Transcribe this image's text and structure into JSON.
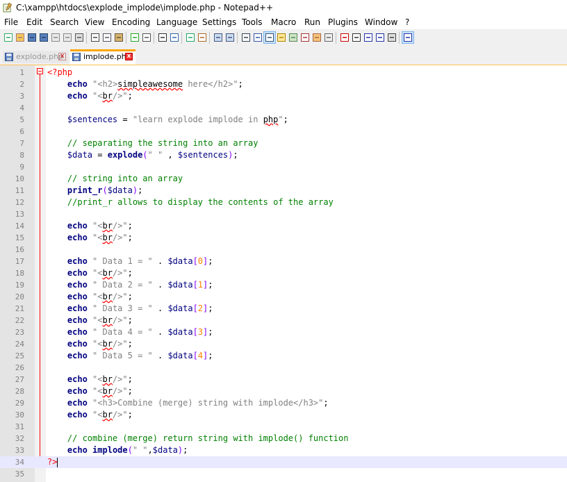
{
  "window": {
    "title": "C:\\xampp\\htdocs\\explode_implode\\implode.php - Notepad++"
  },
  "menu": [
    "File",
    "Edit",
    "Search",
    "View",
    "Encoding",
    "Language",
    "Settings",
    "Tools",
    "Macro",
    "Run",
    "Plugins",
    "Window",
    "?"
  ],
  "tabs": [
    {
      "label": "explode.php",
      "active": false
    },
    {
      "label": "implode.php",
      "active": true
    }
  ],
  "editor": {
    "current_line": 34,
    "lines": [
      [
        [
          "php",
          "<?php"
        ]
      ],
      [
        [
          "t",
          "    "
        ],
        [
          "kw",
          "echo"
        ],
        [
          "t",
          " "
        ],
        [
          "str",
          "\"<h2>"
        ],
        [
          "sq",
          "simpleawesome"
        ],
        [
          "str",
          " here</h2>\""
        ],
        [
          "t",
          ";"
        ]
      ],
      [
        [
          "t",
          "    "
        ],
        [
          "kw",
          "echo"
        ],
        [
          "t",
          " "
        ],
        [
          "str",
          "\"<"
        ],
        [
          "sq",
          "br"
        ],
        [
          "str",
          "/>\""
        ],
        [
          "t",
          ";"
        ]
      ],
      [],
      [
        [
          "t",
          "    "
        ],
        [
          "var",
          "$sentences"
        ],
        [
          "t",
          " = "
        ],
        [
          "str",
          "\"learn explode implode in "
        ],
        [
          "sq",
          "php"
        ],
        [
          "str",
          "\""
        ],
        [
          "t",
          ";"
        ]
      ],
      [],
      [
        [
          "t",
          "    "
        ],
        [
          "cmt",
          "// separating the string into an array"
        ]
      ],
      [
        [
          "t",
          "    "
        ],
        [
          "var",
          "$data"
        ],
        [
          "t",
          " = "
        ],
        [
          "kw",
          "explode"
        ],
        [
          "op",
          "("
        ],
        [
          "str",
          "\" \""
        ],
        [
          "t",
          " , "
        ],
        [
          "var",
          "$sentences"
        ],
        [
          "op",
          ")"
        ],
        [
          "t",
          ";"
        ]
      ],
      [],
      [
        [
          "t",
          "    "
        ],
        [
          "cmt",
          "// string into an array"
        ]
      ],
      [
        [
          "t",
          "    "
        ],
        [
          "kw",
          "print_r"
        ],
        [
          "op",
          "("
        ],
        [
          "var",
          "$data"
        ],
        [
          "op",
          ")"
        ],
        [
          "t",
          ";"
        ]
      ],
      [
        [
          "t",
          "    "
        ],
        [
          "cmt",
          "//print_r allows to display the contents of the array"
        ]
      ],
      [],
      [
        [
          "t",
          "    "
        ],
        [
          "kw",
          "echo"
        ],
        [
          "t",
          " "
        ],
        [
          "str",
          "\"<"
        ],
        [
          "sq",
          "br"
        ],
        [
          "str",
          "/>\""
        ],
        [
          "t",
          ";"
        ]
      ],
      [
        [
          "t",
          "    "
        ],
        [
          "kw",
          "echo"
        ],
        [
          "t",
          " "
        ],
        [
          "str",
          "\"<"
        ],
        [
          "sq",
          "br"
        ],
        [
          "str",
          "/>\""
        ],
        [
          "t",
          ";"
        ]
      ],
      [],
      [
        [
          "t",
          "    "
        ],
        [
          "kw",
          "echo"
        ],
        [
          "t",
          " "
        ],
        [
          "str",
          "\" Data 1 = \""
        ],
        [
          "t",
          " . "
        ],
        [
          "var",
          "$data"
        ],
        [
          "op",
          "["
        ],
        [
          "num",
          "0"
        ],
        [
          "op",
          "]"
        ],
        [
          "t",
          ";"
        ]
      ],
      [
        [
          "t",
          "    "
        ],
        [
          "kw",
          "echo"
        ],
        [
          "t",
          " "
        ],
        [
          "str",
          "\"<"
        ],
        [
          "sq",
          "br"
        ],
        [
          "str",
          "/>\""
        ],
        [
          "t",
          ";"
        ]
      ],
      [
        [
          "t",
          "    "
        ],
        [
          "kw",
          "echo"
        ],
        [
          "t",
          " "
        ],
        [
          "str",
          "\" Data 2 = \""
        ],
        [
          "t",
          " . "
        ],
        [
          "var",
          "$data"
        ],
        [
          "op",
          "["
        ],
        [
          "num",
          "1"
        ],
        [
          "op",
          "]"
        ],
        [
          "t",
          ";"
        ]
      ],
      [
        [
          "t",
          "    "
        ],
        [
          "kw",
          "echo"
        ],
        [
          "t",
          " "
        ],
        [
          "str",
          "\"<"
        ],
        [
          "sq",
          "br"
        ],
        [
          "str",
          "/>\""
        ],
        [
          "t",
          ";"
        ]
      ],
      [
        [
          "t",
          "    "
        ],
        [
          "kw",
          "echo"
        ],
        [
          "t",
          " "
        ],
        [
          "str",
          "\" Data 3 = \""
        ],
        [
          "t",
          " . "
        ],
        [
          "var",
          "$data"
        ],
        [
          "op",
          "["
        ],
        [
          "num",
          "2"
        ],
        [
          "op",
          "]"
        ],
        [
          "t",
          ";"
        ]
      ],
      [
        [
          "t",
          "    "
        ],
        [
          "kw",
          "echo"
        ],
        [
          "t",
          " "
        ],
        [
          "str",
          "\"<"
        ],
        [
          "sq",
          "br"
        ],
        [
          "str",
          "/>\""
        ],
        [
          "t",
          ";"
        ]
      ],
      [
        [
          "t",
          "    "
        ],
        [
          "kw",
          "echo"
        ],
        [
          "t",
          " "
        ],
        [
          "str",
          "\" Data 4 = \""
        ],
        [
          "t",
          " . "
        ],
        [
          "var",
          "$data"
        ],
        [
          "op",
          "["
        ],
        [
          "num",
          "3"
        ],
        [
          "op",
          "]"
        ],
        [
          "t",
          ";"
        ]
      ],
      [
        [
          "t",
          "    "
        ],
        [
          "kw",
          "echo"
        ],
        [
          "t",
          " "
        ],
        [
          "str",
          "\"<"
        ],
        [
          "sq",
          "br"
        ],
        [
          "str",
          "/>\""
        ],
        [
          "t",
          ";"
        ]
      ],
      [
        [
          "t",
          "    "
        ],
        [
          "kw",
          "echo"
        ],
        [
          "t",
          " "
        ],
        [
          "str",
          "\" Data 5 = \""
        ],
        [
          "t",
          " . "
        ],
        [
          "var",
          "$data"
        ],
        [
          "op",
          "["
        ],
        [
          "num",
          "4"
        ],
        [
          "op",
          "]"
        ],
        [
          "t",
          ";"
        ]
      ],
      [],
      [
        [
          "t",
          "    "
        ],
        [
          "kw",
          "echo"
        ],
        [
          "t",
          " "
        ],
        [
          "str",
          "\"<"
        ],
        [
          "sq",
          "br"
        ],
        [
          "str",
          "/>\""
        ],
        [
          "t",
          ";"
        ]
      ],
      [
        [
          "t",
          "    "
        ],
        [
          "kw",
          "echo"
        ],
        [
          "t",
          " "
        ],
        [
          "str",
          "\"<"
        ],
        [
          "sq",
          "br"
        ],
        [
          "str",
          "/>\""
        ],
        [
          "t",
          ";"
        ]
      ],
      [
        [
          "t",
          "    "
        ],
        [
          "kw",
          "echo"
        ],
        [
          "t",
          " "
        ],
        [
          "str",
          "\"<h3>Combine (merge) string with implode</h3>\""
        ],
        [
          "t",
          ";"
        ]
      ],
      [
        [
          "t",
          "    "
        ],
        [
          "kw",
          "echo"
        ],
        [
          "t",
          " "
        ],
        [
          "str",
          "\"<"
        ],
        [
          "sq",
          "br"
        ],
        [
          "str",
          "/>\""
        ],
        [
          "t",
          ";"
        ]
      ],
      [],
      [
        [
          "t",
          "    "
        ],
        [
          "cmt",
          "// combine (merge) return string with implode() function"
        ]
      ],
      [
        [
          "t",
          "    "
        ],
        [
          "kw",
          "echo"
        ],
        [
          "t",
          " "
        ],
        [
          "kw",
          "implode"
        ],
        [
          "op",
          "("
        ],
        [
          "str",
          "\" \""
        ],
        [
          "t",
          ","
        ],
        [
          "var",
          "$data"
        ],
        [
          "op",
          ")"
        ],
        [
          "t",
          ";"
        ]
      ],
      [
        [
          "php",
          "?>"
        ]
      ],
      []
    ]
  }
}
